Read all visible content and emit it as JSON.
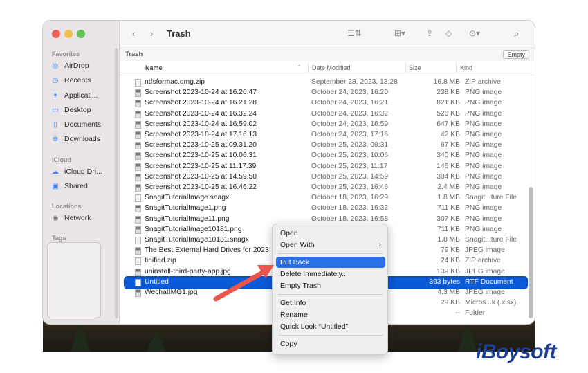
{
  "window": {
    "title": "Trash"
  },
  "colors": {
    "accent": "#0a59d6",
    "highlight": "#2b6fe6",
    "arrow": "#e8564b",
    "brand": "#1d3f95"
  },
  "sidebar": {
    "sections": [
      {
        "label": "Favorites"
      },
      {
        "label": "iCloud"
      },
      {
        "label": "Locations"
      },
      {
        "label": "Tags"
      }
    ],
    "items": [
      {
        "label": "AirDrop",
        "icon": "airdrop-icon"
      },
      {
        "label": "Recents",
        "icon": "clock-icon"
      },
      {
        "label": "Applicati...",
        "icon": "applications-icon"
      },
      {
        "label": "Desktop",
        "icon": "desktop-icon"
      },
      {
        "label": "Documents",
        "icon": "document-icon"
      },
      {
        "label": "Downloads",
        "icon": "download-icon"
      },
      {
        "label": "iCloud Dri...",
        "icon": "cloud-icon"
      },
      {
        "label": "Shared",
        "icon": "shared-folder-icon"
      },
      {
        "label": "Network",
        "icon": "network-icon"
      }
    ]
  },
  "pathbar": {
    "label": "Trash",
    "empty_label": "Empty"
  },
  "columns": {
    "name": "Name",
    "date": "Date Modified",
    "size": "Size",
    "kind": "Kind"
  },
  "files": [
    {
      "name": "ntfsformac.dmg.zip",
      "date": "September 28, 2023, 13:28",
      "size": "16.8 MB",
      "kind": "ZIP archive"
    },
    {
      "name": "Screenshot 2023-10-24 at 16.20.47",
      "date": "October 24, 2023, 16:20",
      "size": "238 KB",
      "kind": "PNG image"
    },
    {
      "name": "Screenshot 2023-10-24 at 16.21.28",
      "date": "October 24, 2023, 16:21",
      "size": "821 KB",
      "kind": "PNG image"
    },
    {
      "name": "Screenshot 2023-10-24 at 16.32.24",
      "date": "October 24, 2023, 16:32",
      "size": "526 KB",
      "kind": "PNG image"
    },
    {
      "name": "Screenshot 2023-10-24 at 16.59.02",
      "date": "October 24, 2023, 16:59",
      "size": "647 KB",
      "kind": "PNG image"
    },
    {
      "name": "Screenshot 2023-10-24 at 17.16.13",
      "date": "October 24, 2023, 17:16",
      "size": "42 KB",
      "kind": "PNG image"
    },
    {
      "name": "Screenshot 2023-10-25 at 09.31.20",
      "date": "October 25, 2023, 09:31",
      "size": "67 KB",
      "kind": "PNG image"
    },
    {
      "name": "Screenshot 2023-10-25 at 10.06.31",
      "date": "October 25, 2023, 10:06",
      "size": "340 KB",
      "kind": "PNG image"
    },
    {
      "name": "Screenshot 2023-10-25 at 11.17.39",
      "date": "October 25, 2023, 11:17",
      "size": "146 KB",
      "kind": "PNG image"
    },
    {
      "name": "Screenshot 2023-10-25 at 14.59.50",
      "date": "October 25, 2023, 14:59",
      "size": "304 KB",
      "kind": "PNG image"
    },
    {
      "name": "Screenshot 2023-10-25 at 16.46.22",
      "date": "October 25, 2023, 16:46",
      "size": "2.4 MB",
      "kind": "PNG image"
    },
    {
      "name": "SnagitTutorialImage.snagx",
      "date": "October 18, 2023, 16:29",
      "size": "1.8 MB",
      "kind": "Snagit...ture File"
    },
    {
      "name": "SnagitTutorialImage1.png",
      "date": "October 18, 2023, 16:32",
      "size": "711 KB",
      "kind": "PNG image"
    },
    {
      "name": "SnagitTutorialImage11.png",
      "date": "October 18, 2023, 16:58",
      "size": "307 KB",
      "kind": "PNG image"
    },
    {
      "name": "SnagitTutorialImage10181.png",
      "date": "2",
      "size": "711 KB",
      "kind": "PNG image"
    },
    {
      "name": "SnagitTutorialImage10181.snagx",
      "date": "5",
      "size": "1.8 MB",
      "kind": "Snagit...ture File"
    },
    {
      "name": "The Best External Hard Drives for 2023",
      "date": "",
      "size": "79 KB",
      "kind": "JPEG image"
    },
    {
      "name": "tinified.zip",
      "date": "",
      "size": "24 KB",
      "kind": "ZIP archive"
    },
    {
      "name": "uninstall-third-party-app.jpg",
      "date": "",
      "size": "139 KB",
      "kind": "JPEG image"
    },
    {
      "name": "Untitled",
      "date": "",
      "size": "393 bytes",
      "kind": "RTF Document"
    },
    {
      "name": "WechatIMG1.jpg",
      "date": "2",
      "size": "4.3 MB",
      "kind": "JPEG image"
    },
    {
      "name": "",
      "date": ":54",
      "size": "29 KB",
      "kind": "Micros...k (.xlsx)"
    },
    {
      "name": "",
      "date": ":51",
      "size": "--",
      "kind": "Folder"
    }
  ],
  "context_menu": {
    "items": [
      {
        "label": "Open"
      },
      {
        "label": "Open With"
      },
      {
        "label": "Put Back"
      },
      {
        "label": "Delete Immediately..."
      },
      {
        "label": "Empty Trash"
      },
      {
        "label": "Get Info"
      },
      {
        "label": "Rename"
      },
      {
        "label": "Quick Look “Untitled”"
      },
      {
        "label": "Copy"
      }
    ]
  },
  "brand": {
    "logo_text": "iBoysoft"
  }
}
